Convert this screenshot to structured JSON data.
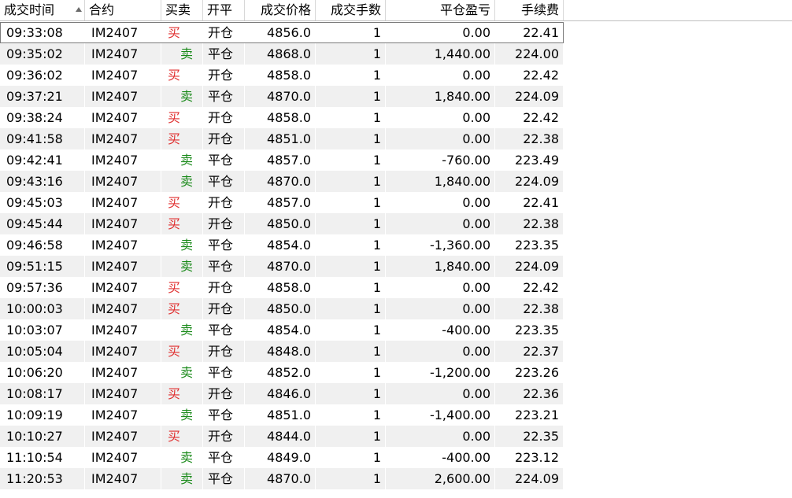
{
  "table": {
    "columns": [
      "成交时间",
      "合约",
      "买卖",
      "开平",
      "成交价格",
      "成交手数",
      "平仓盈亏",
      "手续费"
    ],
    "rows": [
      {
        "time": "09:33:08",
        "code": "IM2407",
        "side": "买",
        "oc": "开仓",
        "price": "4856.0",
        "qty": "1",
        "pnl": "0.00",
        "fee": "22.41"
      },
      {
        "time": "09:35:02",
        "code": "IM2407",
        "side": "卖",
        "oc": "平仓",
        "price": "4868.0",
        "qty": "1",
        "pnl": "1,440.00",
        "fee": "224.00"
      },
      {
        "time": "09:36:02",
        "code": "IM2407",
        "side": "买",
        "oc": "开仓",
        "price": "4858.0",
        "qty": "1",
        "pnl": "0.00",
        "fee": "22.42"
      },
      {
        "time": "09:37:21",
        "code": "IM2407",
        "side": "卖",
        "oc": "平仓",
        "price": "4870.0",
        "qty": "1",
        "pnl": "1,840.00",
        "fee": "224.09"
      },
      {
        "time": "09:38:24",
        "code": "IM2407",
        "side": "买",
        "oc": "开仓",
        "price": "4858.0",
        "qty": "1",
        "pnl": "0.00",
        "fee": "22.42"
      },
      {
        "time": "09:41:58",
        "code": "IM2407",
        "side": "买",
        "oc": "开仓",
        "price": "4851.0",
        "qty": "1",
        "pnl": "0.00",
        "fee": "22.38"
      },
      {
        "time": "09:42:41",
        "code": "IM2407",
        "side": "卖",
        "oc": "平仓",
        "price": "4857.0",
        "qty": "1",
        "pnl": "-760.00",
        "fee": "223.49"
      },
      {
        "time": "09:43:16",
        "code": "IM2407",
        "side": "卖",
        "oc": "平仓",
        "price": "4870.0",
        "qty": "1",
        "pnl": "1,840.00",
        "fee": "224.09"
      },
      {
        "time": "09:45:03",
        "code": "IM2407",
        "side": "买",
        "oc": "开仓",
        "price": "4857.0",
        "qty": "1",
        "pnl": "0.00",
        "fee": "22.41"
      },
      {
        "time": "09:45:44",
        "code": "IM2407",
        "side": "买",
        "oc": "开仓",
        "price": "4850.0",
        "qty": "1",
        "pnl": "0.00",
        "fee": "22.38"
      },
      {
        "time": "09:46:58",
        "code": "IM2407",
        "side": "卖",
        "oc": "平仓",
        "price": "4854.0",
        "qty": "1",
        "pnl": "-1,360.00",
        "fee": "223.35"
      },
      {
        "time": "09:51:15",
        "code": "IM2407",
        "side": "卖",
        "oc": "平仓",
        "price": "4870.0",
        "qty": "1",
        "pnl": "1,840.00",
        "fee": "224.09"
      },
      {
        "time": "09:57:36",
        "code": "IM2407",
        "side": "买",
        "oc": "开仓",
        "price": "4858.0",
        "qty": "1",
        "pnl": "0.00",
        "fee": "22.42"
      },
      {
        "time": "10:00:03",
        "code": "IM2407",
        "side": "买",
        "oc": "开仓",
        "price": "4850.0",
        "qty": "1",
        "pnl": "0.00",
        "fee": "22.38"
      },
      {
        "time": "10:03:07",
        "code": "IM2407",
        "side": "卖",
        "oc": "平仓",
        "price": "4854.0",
        "qty": "1",
        "pnl": "-400.00",
        "fee": "223.35"
      },
      {
        "time": "10:05:04",
        "code": "IM2407",
        "side": "买",
        "oc": "开仓",
        "price": "4848.0",
        "qty": "1",
        "pnl": "0.00",
        "fee": "22.37"
      },
      {
        "time": "10:06:20",
        "code": "IM2407",
        "side": "卖",
        "oc": "平仓",
        "price": "4852.0",
        "qty": "1",
        "pnl": "-1,200.00",
        "fee": "223.26"
      },
      {
        "time": "10:08:17",
        "code": "IM2407",
        "side": "买",
        "oc": "开仓",
        "price": "4846.0",
        "qty": "1",
        "pnl": "0.00",
        "fee": "22.36"
      },
      {
        "time": "10:09:19",
        "code": "IM2407",
        "side": "卖",
        "oc": "平仓",
        "price": "4851.0",
        "qty": "1",
        "pnl": "-1,400.00",
        "fee": "223.21"
      },
      {
        "time": "10:10:27",
        "code": "IM2407",
        "side": "买",
        "oc": "开仓",
        "price": "4844.0",
        "qty": "1",
        "pnl": "0.00",
        "fee": "22.35"
      },
      {
        "time": "11:10:54",
        "code": "IM2407",
        "side": "卖",
        "oc": "平仓",
        "price": "4849.0",
        "qty": "1",
        "pnl": "-400.00",
        "fee": "223.12"
      },
      {
        "time": "11:20:53",
        "code": "IM2407",
        "side": "卖",
        "oc": "平仓",
        "price": "4870.0",
        "qty": "1",
        "pnl": "2,600.00",
        "fee": "224.09"
      }
    ]
  },
  "colors": {
    "buy": "#e03030",
    "sell": "#1a8a1a"
  },
  "icons": {
    "sort": "sort-ascending-icon"
  }
}
